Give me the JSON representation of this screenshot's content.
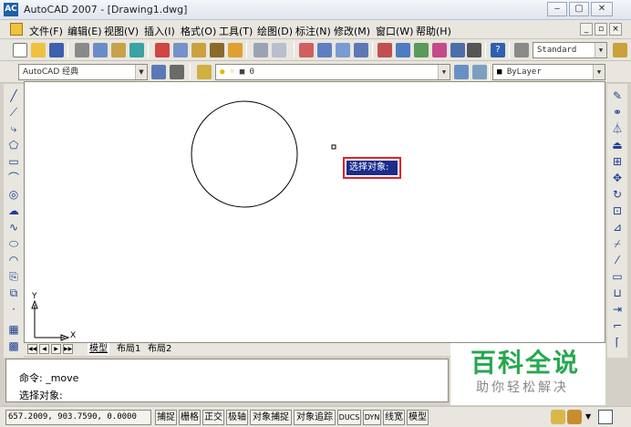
{
  "window": {
    "title": "AutoCAD 2007 - [Drawing1.dwg]",
    "app_icon_label": "AC",
    "controls": [
      "‒",
      "▢",
      "✕"
    ]
  },
  "menubar": {
    "items": [
      "文件(F)",
      "编辑(E)",
      "视图(V)",
      "插入(I)",
      "格式(O)",
      "工具(T)",
      "绘图(D)",
      "标注(N)",
      "修改(M)",
      "窗口(W)",
      "帮助(H)"
    ],
    "mdi_controls": [
      "_",
      "▫",
      "×"
    ]
  },
  "toolbar1": {
    "style_combo": "Standard"
  },
  "toolbar2": {
    "workspace_combo": "AutoCAD 经典",
    "layer_combo": "0",
    "color_combo": "ByLayer"
  },
  "layout_tabs": {
    "tabs": [
      "模型",
      "布局1",
      "布局2"
    ],
    "active": "模型"
  },
  "command": {
    "line1": "命令: _move",
    "line2": "选择对象:"
  },
  "tooltip": {
    "text": "选择对象:"
  },
  "statusbar": {
    "coordinates": "657.2009, 903.7590, 0.0000",
    "buttons": [
      "捕捉",
      "栅格",
      "正交",
      "极轴",
      "对象捕捉",
      "对象追踪",
      "DUCS",
      "DYN",
      "线宽",
      "模型"
    ]
  },
  "ucs": {
    "y_label": "Y",
    "x_label": "X"
  },
  "watermark": {
    "title": "百科全说",
    "subtitle": "助你轻松解决"
  },
  "colors": {
    "titlebar": "#dfe5ee",
    "chrome": "#e8e6de",
    "tooltip_bg": "#1a2c8c",
    "tooltip_border": "#e02424",
    "watermark_green": "#27a84f"
  }
}
